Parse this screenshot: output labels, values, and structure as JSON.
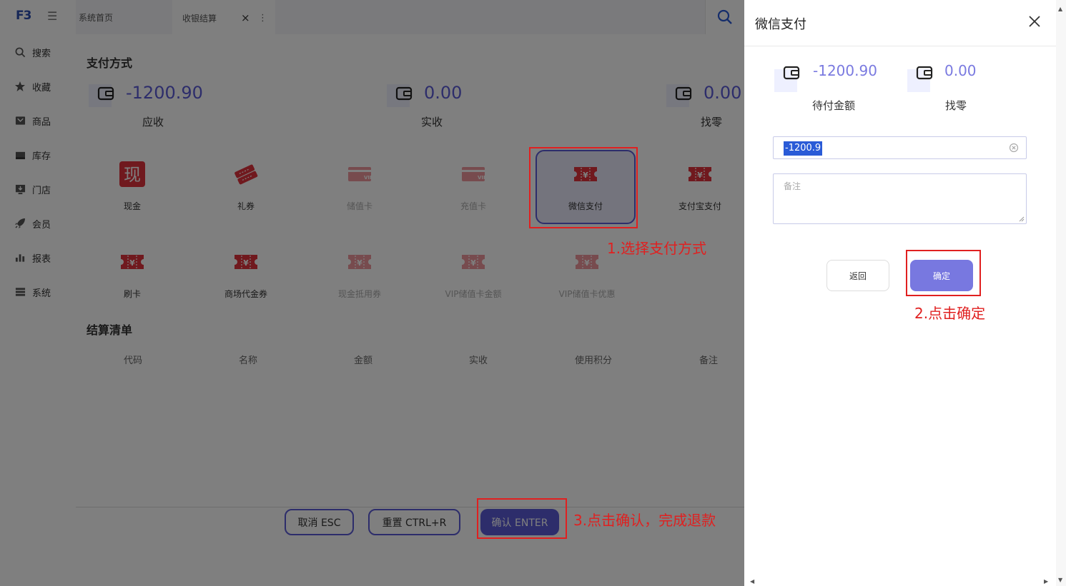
{
  "app": {
    "logo": "F3",
    "tabs": [
      {
        "label": "系统首页"
      },
      {
        "label": "收银结算",
        "close": "×",
        "more": "⋮"
      }
    ],
    "sidebar": [
      {
        "label": "搜索",
        "icon": "search-icon"
      },
      {
        "label": "收藏",
        "icon": "star-icon"
      },
      {
        "label": "商品",
        "icon": "goods-icon"
      },
      {
        "label": "库存",
        "icon": "inventory-icon"
      },
      {
        "label": "门店",
        "icon": "store-icon"
      },
      {
        "label": "会员",
        "icon": "rocket-icon"
      },
      {
        "label": "报表",
        "icon": "chart-icon"
      },
      {
        "label": "系统",
        "icon": "system-icon"
      }
    ]
  },
  "payment": {
    "section_title": "支付方式",
    "amounts": [
      {
        "value": "-1200.90",
        "caption": "应收"
      },
      {
        "value": "0.00",
        "caption": "实收"
      },
      {
        "value": "0.00",
        "caption": "找零"
      }
    ],
    "methods": [
      {
        "label": "现金",
        "icon_text": "现"
      },
      {
        "label": "礼券"
      },
      {
        "label": "储值卡"
      },
      {
        "label": "充值卡"
      },
      {
        "label": "微信支付"
      },
      {
        "label": "支付宝支付"
      },
      {
        "label": "刷卡"
      },
      {
        "label": "商场代金券"
      },
      {
        "label": "现金抵用券"
      },
      {
        "label": "VIP储值卡金额"
      },
      {
        "label": "VIP储值卡优惠"
      }
    ]
  },
  "settlement": {
    "title": "结算清单",
    "columns": [
      "代码",
      "名称",
      "金额",
      "实收",
      "使用积分",
      "备注"
    ]
  },
  "footer": {
    "cancel": "取消 ESC",
    "reset": "重置 CTRL+R",
    "confirm": "确认 ENTER"
  },
  "drawer": {
    "title": "微信支付",
    "pending": {
      "value": "-1200.90",
      "caption": "待付金额"
    },
    "change": {
      "value": "0.00",
      "caption": "找零"
    },
    "amount_input": "-1200.9",
    "remark_placeholder": "备注",
    "back_label": "返回",
    "ok_label": "确定"
  },
  "annotations": {
    "step1": "1.选择支付方式",
    "step2": "2.点击确定",
    "step3": "3.点击确认，完成退款"
  },
  "colors": {
    "accent": "#5a5ad6",
    "annotation": "#e02020",
    "pay_red": "#e0323c"
  }
}
